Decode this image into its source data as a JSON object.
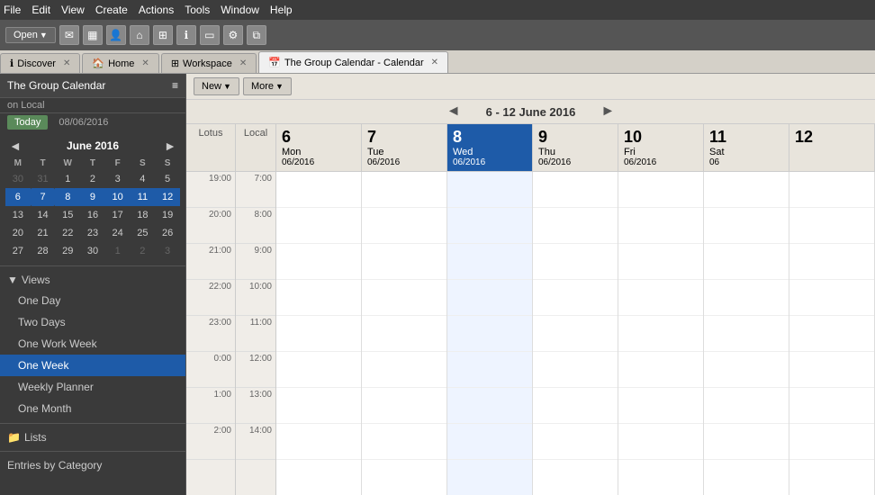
{
  "menubar": {
    "items": [
      "File",
      "Edit",
      "View",
      "Create",
      "Actions",
      "Tools",
      "Window",
      "Help"
    ]
  },
  "toolbar": {
    "open_label": "Open",
    "icons": [
      "envelope",
      "grid",
      "person",
      "home",
      "apps",
      "info",
      "monitor",
      "tools",
      "copy"
    ]
  },
  "tabs": [
    {
      "id": "discover",
      "label": "Discover",
      "icon": "ℹ",
      "closable": true,
      "active": false
    },
    {
      "id": "home",
      "label": "Home",
      "icon": "🏠",
      "closable": true,
      "active": false
    },
    {
      "id": "workspace",
      "label": "Workspace",
      "icon": "⊞",
      "closable": true,
      "active": false
    },
    {
      "id": "group-calendar",
      "label": "The Group Calendar - Calendar",
      "icon": "📅",
      "closable": true,
      "active": true
    }
  ],
  "sidebar": {
    "title": "The Group Calendar",
    "subtitle": "on Local",
    "menu_icon": "≡",
    "today_btn": "Today",
    "today_date": "08/06/2016",
    "mini_cal": {
      "prev": "◄",
      "next": "►",
      "month": "June",
      "year": "2016",
      "day_headers": [
        "M",
        "T",
        "W",
        "T",
        "F",
        "S",
        "S"
      ],
      "weeks": [
        [
          {
            "d": "30",
            "m": "other"
          },
          {
            "d": "31",
            "m": "other"
          },
          {
            "d": "1"
          },
          {
            "d": "2"
          },
          {
            "d": "3"
          },
          {
            "d": "4"
          },
          {
            "d": "5"
          }
        ],
        [
          {
            "d": "6"
          },
          {
            "d": "7",
            "sel": true
          },
          {
            "d": "8"
          },
          {
            "d": "9"
          },
          {
            "d": "10"
          },
          {
            "d": "11"
          },
          {
            "d": "12"
          }
        ],
        [
          {
            "d": "13"
          },
          {
            "d": "14"
          },
          {
            "d": "15"
          },
          {
            "d": "16"
          },
          {
            "d": "17"
          },
          {
            "d": "18"
          },
          {
            "d": "19"
          }
        ],
        [
          {
            "d": "20"
          },
          {
            "d": "21"
          },
          {
            "d": "22"
          },
          {
            "d": "23"
          },
          {
            "d": "24"
          },
          {
            "d": "25"
          },
          {
            "d": "26"
          }
        ],
        [
          {
            "d": "27"
          },
          {
            "d": "28"
          },
          {
            "d": "29"
          },
          {
            "d": "30"
          },
          {
            "d": "1",
            "m": "other"
          },
          {
            "d": "2",
            "m": "other"
          },
          {
            "d": "3",
            "m": "other"
          }
        ]
      ]
    },
    "views_section": {
      "label": "Views",
      "items": [
        {
          "id": "one-day",
          "label": "One Day"
        },
        {
          "id": "two-days",
          "label": "Two Days"
        },
        {
          "id": "one-work-week",
          "label": "One Work Week"
        },
        {
          "id": "one-week",
          "label": "One Week",
          "active": true
        },
        {
          "id": "weekly-planner",
          "label": "Weekly Planner"
        },
        {
          "id": "one-month",
          "label": "One Month"
        }
      ]
    },
    "lists_section": {
      "label": "Lists",
      "icon": "📁"
    },
    "entries_section": {
      "label": "Entries by Category"
    }
  },
  "calendar": {
    "new_label": "New",
    "more_label": "More",
    "prev_arrow": "◄",
    "next_arrow": "►",
    "date_range": "6 - 12 June 2016",
    "col_lotus": "Lotus",
    "col_local": "Local",
    "days": [
      {
        "num": "6",
        "name": "Mon",
        "sub": "06/2016",
        "today": false
      },
      {
        "num": "7",
        "name": "Tue",
        "sub": "06/2016",
        "today": false
      },
      {
        "num": "8",
        "name": "Wed",
        "sub": "06/2016",
        "today": true
      },
      {
        "num": "9",
        "name": "Thu",
        "sub": "06/2016",
        "today": false
      },
      {
        "num": "10",
        "name": "Fri",
        "sub": "06/2016",
        "today": false
      },
      {
        "num": "11",
        "name": "Sat",
        "sub": "06",
        "today": false
      },
      {
        "num": "12",
        "name": "",
        "sub": "",
        "today": false
      }
    ],
    "lotus_times": [
      "19:00",
      "20:00",
      "21:00",
      "22:00",
      "23:00",
      "0:00",
      "1:00",
      "2:00"
    ],
    "local_times": [
      "7:00",
      "8:00",
      "9:00",
      "10:00",
      "11:00",
      "12:00",
      "13:00",
      "14:00"
    ]
  }
}
